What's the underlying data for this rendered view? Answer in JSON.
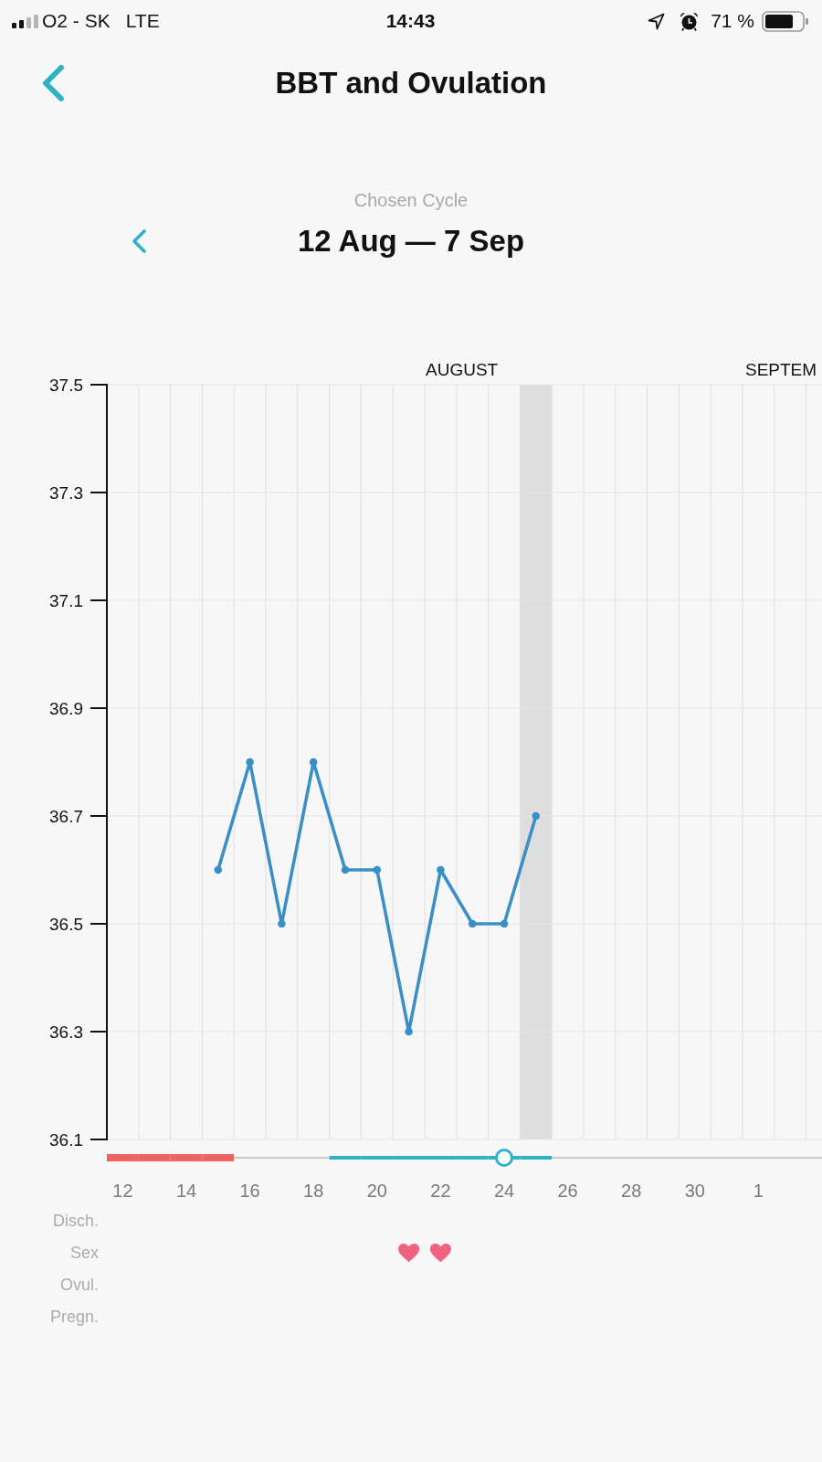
{
  "status_bar": {
    "carrier": "O2 - SK",
    "network": "LTE",
    "time": "14:43",
    "battery": "71 %"
  },
  "nav_bar": {
    "title": "BBT and Ovulation"
  },
  "cycle_picker": {
    "caption": "Chosen Cycle",
    "range": "12 Aug — 7 Sep"
  },
  "chart": {
    "month_labels": [
      {
        "label": "AUGUST"
      },
      {
        "label": "SEPTEM"
      }
    ],
    "chart_data": {
      "type": "line",
      "x": [
        15,
        16,
        17,
        18,
        19,
        20,
        21,
        22,
        23,
        24,
        25
      ],
      "series": [
        {
          "color": "#3a8fc7",
          "marker": "circle",
          "values": [
            36.6,
            36.8,
            36.5,
            36.8,
            36.6,
            36.6,
            36.3,
            36.6,
            36.5,
            36.5,
            36.7
          ]
        }
      ],
      "xlim": [
        11.5,
        34
      ],
      "ylim": [
        36.1,
        37.5
      ],
      "xticks": [
        12,
        14,
        16,
        18,
        20,
        22,
        24,
        26,
        28,
        30
      ],
      "yticks": [
        36.1,
        36.3,
        36.5,
        36.7,
        36.9,
        37.1,
        37.3,
        37.5
      ],
      "grid": true,
      "bands": [
        {
          "axis": "x",
          "from": 24.5,
          "to": 25.5,
          "color": "#dedede"
        }
      ]
    },
    "next_month_ticks": [
      {
        "label": "1"
      }
    ],
    "days": [
      {
        "kind": "period",
        "ovulation": false,
        "sex": false
      },
      {
        "kind": "period",
        "ovulation": false,
        "sex": false
      },
      {
        "kind": "period",
        "ovulation": false,
        "sex": false
      },
      {
        "kind": "period",
        "ovulation": false,
        "sex": false
      },
      {
        "kind": "plain",
        "ovulation": false,
        "sex": false
      },
      {
        "kind": "plain",
        "ovulation": false,
        "sex": false
      },
      {
        "kind": "plain",
        "ovulation": false,
        "sex": false
      },
      {
        "kind": "fertile",
        "ovulation": false,
        "sex": false
      },
      {
        "kind": "fertile",
        "ovulation": false,
        "sex": false
      },
      {
        "kind": "fertile",
        "ovulation": false,
        "sex": true
      },
      {
        "kind": "fertile",
        "ovulation": false,
        "sex": true
      },
      {
        "kind": "fertile",
        "ovulation": false,
        "sex": false
      },
      {
        "kind": "fertile",
        "ovulation": true,
        "sex": false
      },
      {
        "kind": "fertile",
        "ovulation": false,
        "sex": false
      }
    ],
    "log_rows": [
      {
        "kind": "discharge",
        "label": "Disch."
      },
      {
        "kind": "sex",
        "label": "Sex"
      },
      {
        "kind": "ovulation",
        "label": "Ovul."
      },
      {
        "kind": "pregnancy",
        "label": "Pregn."
      }
    ]
  }
}
